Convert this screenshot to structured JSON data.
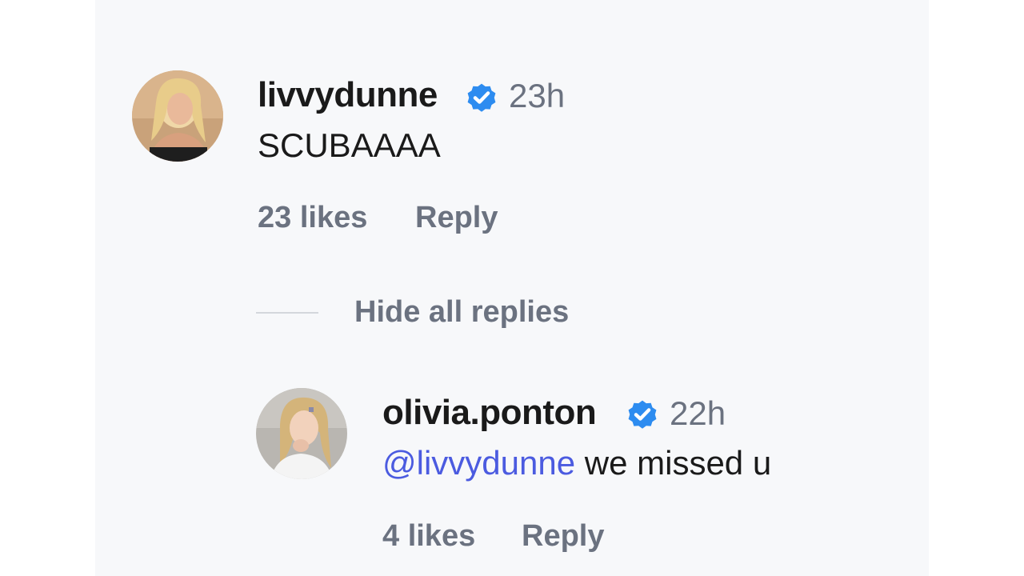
{
  "comment": {
    "username": "livvydunne",
    "verified": true,
    "time": "23h",
    "text": "SCUBAAAA",
    "likes_label": "23 likes",
    "reply_label": "Reply"
  },
  "replies_toggle": {
    "label": "Hide all replies"
  },
  "reply": {
    "username": "olivia.ponton",
    "verified": true,
    "time": "22h",
    "mention": "@livvydunne",
    "text": " we missed u",
    "likes_label": "4 likes",
    "reply_label": "Reply"
  },
  "colors": {
    "panel_bg": "#f7f8fa",
    "verified_blue": "#2d8cf0",
    "mention_blue": "#4b5be0",
    "muted_text": "#6b7280"
  }
}
